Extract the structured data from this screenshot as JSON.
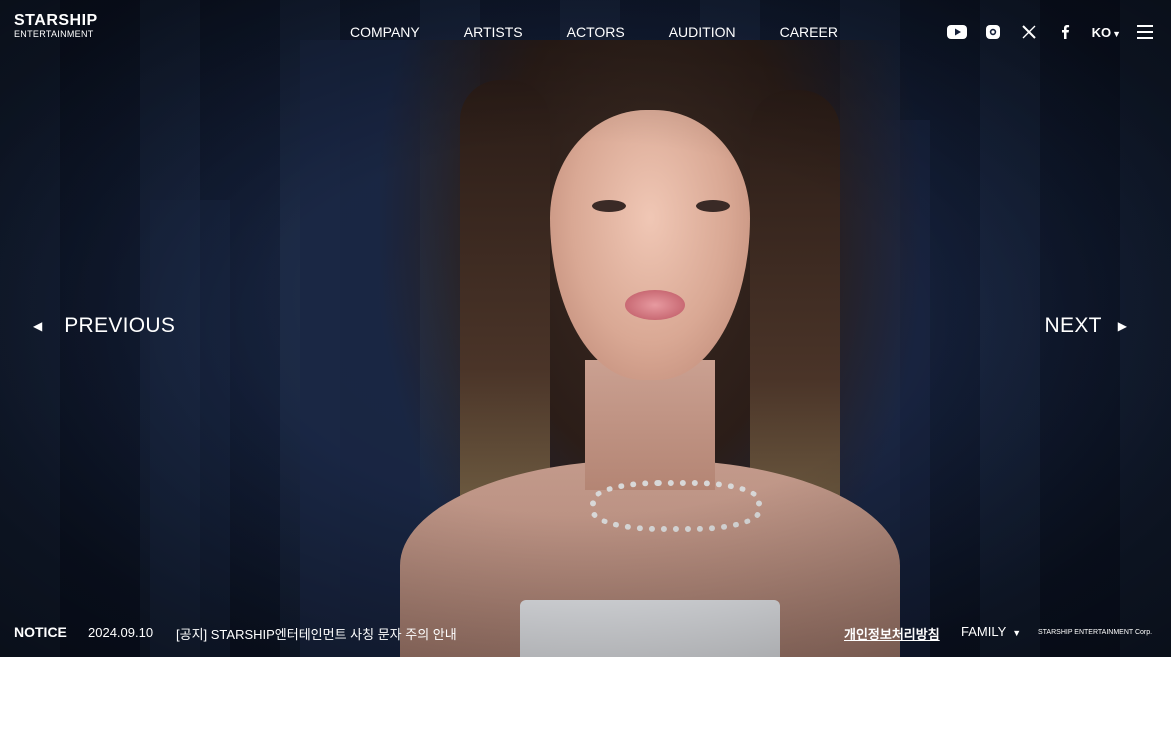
{
  "brand": {
    "name": "STARSHIP",
    "sub": "ENTERTAINMENT"
  },
  "nav": {
    "items": [
      {
        "label": "COMPANY"
      },
      {
        "label": "ARTISTS"
      },
      {
        "label": "ACTORS"
      },
      {
        "label": "AUDITION"
      },
      {
        "label": "CAREER"
      }
    ]
  },
  "social": {
    "icons": [
      "youtube-icon",
      "instagram-icon",
      "x-icon",
      "facebook-icon"
    ]
  },
  "language": {
    "current": "KO",
    "caret": "▼"
  },
  "slider": {
    "prev_label": "PREVIOUS",
    "next_label": "NEXT",
    "prev_glyph": "◀",
    "next_glyph": "▶"
  },
  "notice": {
    "label": "NOTICE",
    "date": "2024.09.10",
    "text": "[공지] STARSHIP엔터테인먼트 사칭 문자 주의 안내"
  },
  "footer": {
    "privacy_label": "개인정보처리방침",
    "family_label": "FAMILY",
    "family_caret": "▼",
    "copyright": "STARSHIP ENTERTAINMENT Corp."
  },
  "colors": {
    "text": "#ffffff",
    "page_bg": "#ffffff",
    "hero_bg": "#15203a"
  }
}
